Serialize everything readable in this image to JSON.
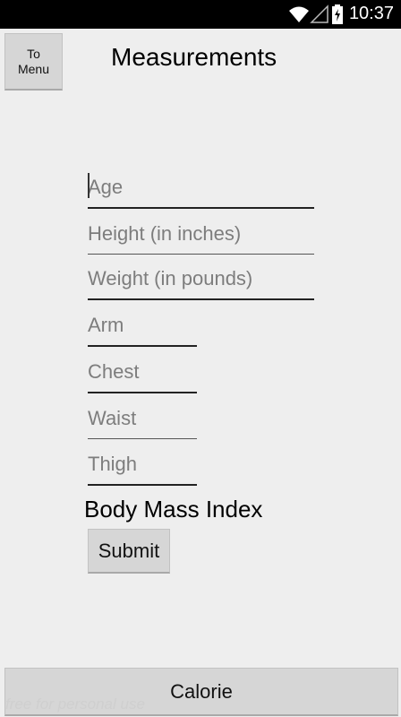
{
  "status_bar": {
    "time": "10:37",
    "icons": [
      "wifi-icon",
      "signal-icon",
      "battery-charging-icon"
    ]
  },
  "header": {
    "menu_button_label_line1": "To",
    "menu_button_label_line2": "Menu",
    "title": "Measurements"
  },
  "form": {
    "age": {
      "placeholder": "Age",
      "value": ""
    },
    "height": {
      "placeholder": "Height (in inches)",
      "value": ""
    },
    "weight": {
      "placeholder": "Weight (in pounds)",
      "value": ""
    },
    "arm": {
      "placeholder": "Arm",
      "value": ""
    },
    "chest": {
      "placeholder": "Chest",
      "value": ""
    },
    "waist": {
      "placeholder": "Waist",
      "value": ""
    },
    "thigh": {
      "placeholder": "Thigh",
      "value": ""
    },
    "bmi_label": "Body Mass Index",
    "submit_label": "Submit"
  },
  "footer": {
    "calorie_label": "Calorie",
    "watermark": "free for personal use"
  }
}
